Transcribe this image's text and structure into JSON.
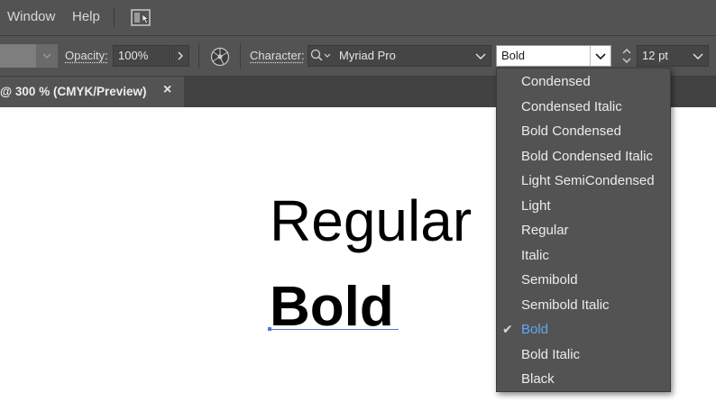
{
  "menubar": {
    "items": [
      {
        "label": "Window"
      },
      {
        "label": "Help"
      }
    ],
    "arrange_icon": "arrange-documents-icon"
  },
  "controlbar": {
    "opacity_label": "Opacity:",
    "opacity_value": "100%",
    "recolor_icon": "recolor-artwork-icon",
    "character_label": "Character:",
    "font_family": "Myriad Pro",
    "font_style": "Bold",
    "font_size": "12 pt"
  },
  "document_tab": {
    "title": "@ 300 % (CMYK/Preview)",
    "close": "×"
  },
  "canvas": {
    "text_regular": "Regular",
    "text_bold": "Bold",
    "selection_color": "#4c7ad6"
  },
  "font_style_dropdown": {
    "selected_color": "#62a7f4",
    "check": "✔",
    "items": [
      {
        "label": "Condensed"
      },
      {
        "label": "Condensed Italic"
      },
      {
        "label": "Bold Condensed"
      },
      {
        "label": "Bold Condensed Italic"
      },
      {
        "label": "Light SemiCondensed"
      },
      {
        "label": "Light"
      },
      {
        "label": "Regular"
      },
      {
        "label": "Italic"
      },
      {
        "label": "Semibold"
      },
      {
        "label": "Semibold Italic"
      },
      {
        "label": "Bold",
        "selected": true
      },
      {
        "label": "Bold Italic"
      },
      {
        "label": "Black"
      }
    ]
  }
}
